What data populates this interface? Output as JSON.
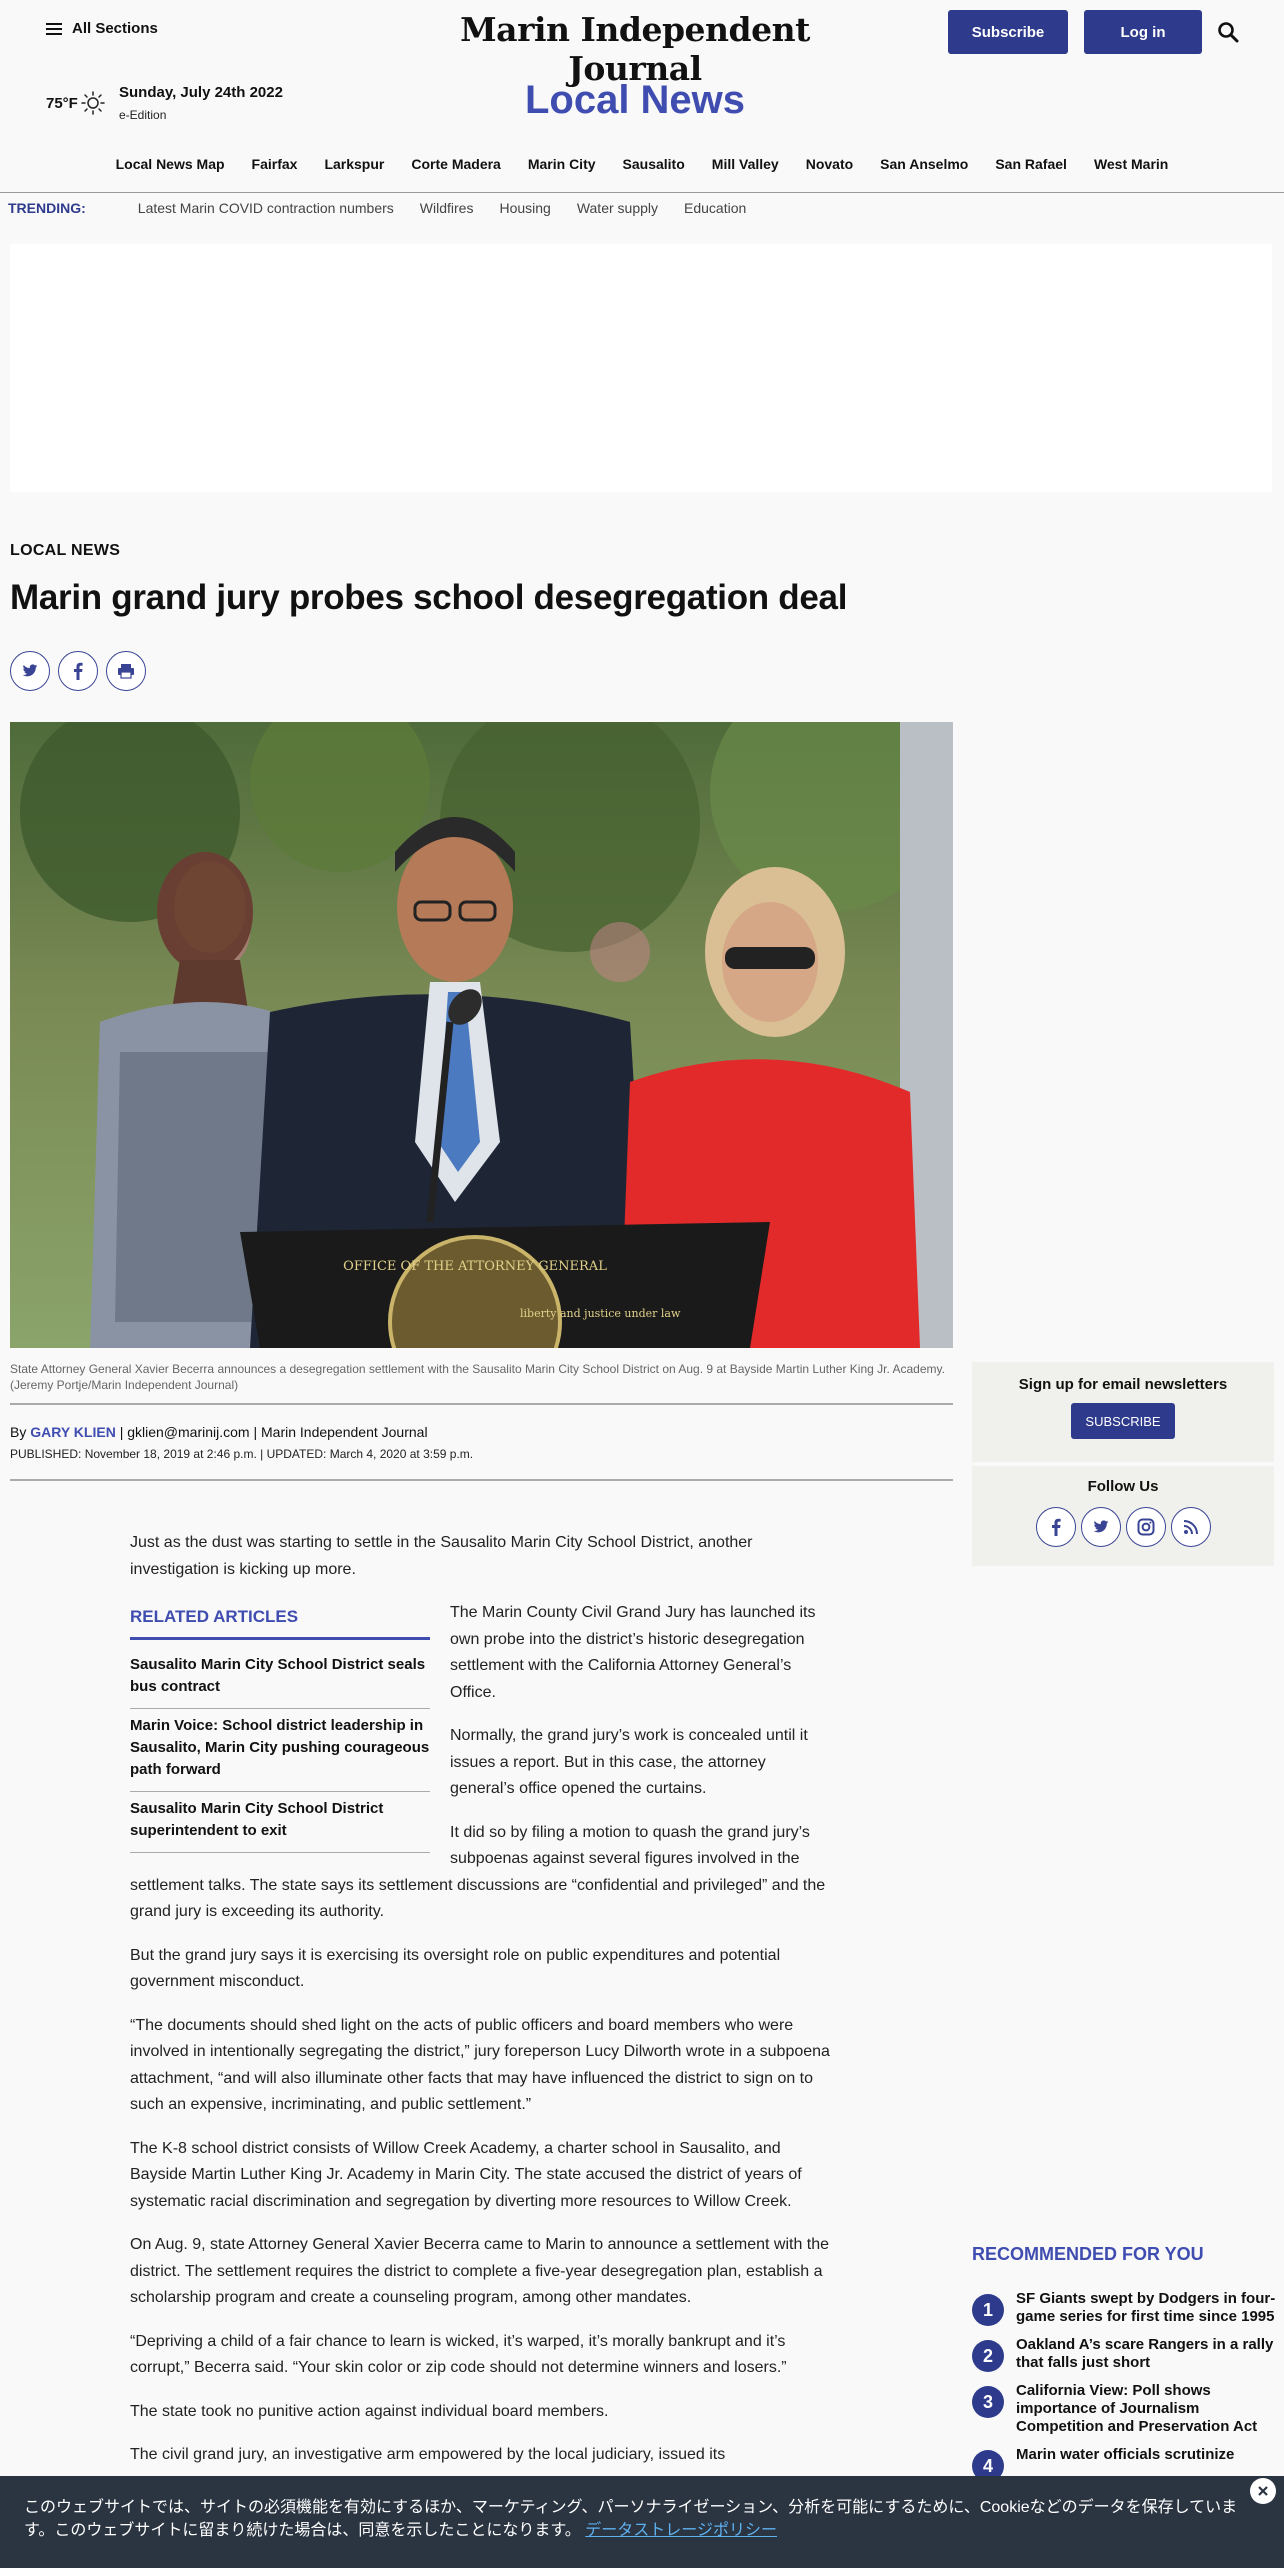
{
  "header": {
    "all_sections": "All Sections",
    "logo": "Marin Independent Journal",
    "subscribe": "Subscribe",
    "login": "Log in",
    "temperature": "75°F",
    "date": "Sunday, July 24th 2022",
    "eedition": "e-Edition",
    "section_title": "Local News"
  },
  "nav": {
    "items": [
      "Local News Map",
      "Fairfax",
      "Larkspur",
      "Corte Madera",
      "Marin City",
      "Sausalito",
      "Mill Valley",
      "Novato",
      "San Anselmo",
      "San Rafael",
      "West Marin"
    ]
  },
  "trending": {
    "label": "TRENDING:",
    "items": [
      "Latest Marin COVID contraction numbers",
      "Wildfires",
      "Housing",
      "Water supply",
      "Education"
    ]
  },
  "article": {
    "kicker": "LOCAL NEWS",
    "headline": "Marin grand jury probes school desegregation deal",
    "photo_seal_text": "OFFICE OF THE ATTORNEY GENERAL",
    "photo_seal_motto": "liberty and justice under law",
    "caption": "State Attorney General Xavier Becerra announces a desegregation settlement with the Sausalito Marin City School District on Aug. 9 at Bayside Martin Luther King Jr. Academy. (Jeremy Portje/Marin Independent Journal)",
    "by": "By",
    "author": "GARY KLIEN",
    "byline_rest": " | gklien@marinij.com | Marin Independent Journal",
    "dates": "PUBLISHED: November 18, 2019 at 2:46 p.m. | UPDATED: March 4, 2020 at 3:59 p.m.",
    "lead": "Just as the dust was starting to settle in the Sausalito Marin City School District, another investigation is kicking up more.",
    "paragraphs": [
      "The Marin County Civil Grand Jury has launched its own probe into the district’s historic desegregation settlement with the California Attorney General’s Office.",
      "Normally, the grand jury’s work is concealed until it issues a report. But in this case, the attorney general’s office opened the curtains.",
      "It did so by filing a motion to quash the grand jury’s subpoenas against several figures involved in the settlement talks. The state says its settlement discussions are “confidential and privileged” and the grand jury is exceeding its authority.",
      "But the grand jury says it is exercising its oversight role on public expenditures and potential government misconduct.",
      "“The documents should shed light on the acts of public officers and board members who were involved in intentionally segregating the district,” jury foreperson Lucy Dilworth wrote in a subpoena attachment, “and will also illuminate other facts that may have influenced the district to sign on to such an expensive, incriminating, and public settlement.”",
      "The K-8 school district consists of Willow Creek Academy, a charter school in Sausalito, and Bayside Martin Luther King Jr. Academy in Marin City. The state accused the district of years of systematic racial discrimination and segregation by diverting more resources to Willow Creek.",
      "On Aug. 9, state Attorney General Xavier Becerra came to Marin to announce a settlement with the district. The settlement requires the district to complete a five-year desegregation plan, establish a scholarship program and create a counseling program, among other mandates.",
      "“Depriving a child of a fair chance to learn is wicked, it’s warped, it’s morally bankrupt and it’s corrupt,” Becerra said. “Your skin color or zip code should not determine winners and losers.”",
      "The state took no punitive action against individual board members.",
      "The civil grand jury, an investigative arm empowered by the local judiciary, issued its"
    ]
  },
  "related": {
    "title": "RELATED ARTICLES",
    "items": [
      "Sausalito Marin City School District seals bus contract",
      "Marin Voice: School district leadership in Sausalito, Marin City pushing courageous path forward",
      "Sausalito Marin City School District superintendent to exit"
    ]
  },
  "sidebar": {
    "newsletter_title": "Sign up for email newsletters",
    "newsletter_button": "SUBSCRIBE",
    "follow_title": "Follow Us",
    "recommended_title": "RECOMMENDED FOR YOU",
    "recommended": [
      {
        "num": "1",
        "title": "SF Giants swept by Dodgers in four-game series for first time since 1995"
      },
      {
        "num": "2",
        "title": "Oakland A’s scare Rangers in a rally that falls just short"
      },
      {
        "num": "3",
        "title": "California View: Poll shows importance of Journalism Competition and Preservation Act"
      },
      {
        "num": "4",
        "title": "Marin water officials scrutinize"
      }
    ]
  },
  "cookie": {
    "text": "このウェブサイトでは、サイトの必須機能を有効にするほか、マーケティング、パーソナライゼーション、分析を可能にするために、Cookieなどのデータを保存しています。このウェブサイトに留まり続けた場合は、同意を示したことになります。",
    "link": "データストレージポリシー"
  },
  "colors": {
    "brand_blue": "#2e3a8c",
    "accent_blue": "#3f4db0",
    "cookie_bg": "#2b3542",
    "link_blue": "#5eb0ef"
  }
}
